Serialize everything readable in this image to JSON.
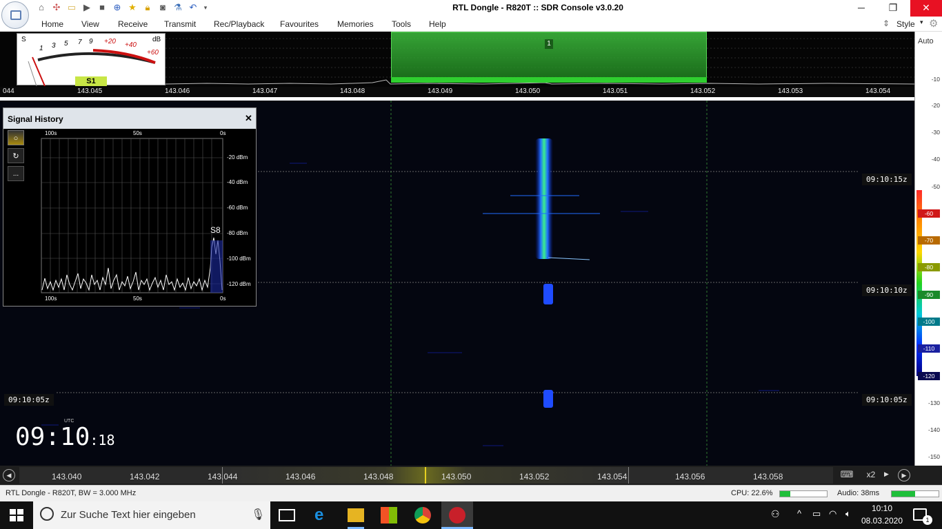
{
  "window": {
    "title": "RTL Dongle - R820T :: SDR Console v3.0.20",
    "minimize": "─",
    "restore": "❐",
    "close": "✕"
  },
  "quick_access": [
    "home-icon",
    "settings-icon",
    "folder-icon",
    "play-icon",
    "stop-icon",
    "add-icon",
    "star-icon",
    "lock-icon",
    "camera-icon",
    "flask-icon",
    "undo-icon",
    "dropdown-icon"
  ],
  "ribbon": {
    "tabs": [
      "Home",
      "View",
      "Receive",
      "Transmit",
      "Rec/Playback",
      "Favourites",
      "Memories",
      "Tools",
      "Help"
    ],
    "style_label": "Style"
  },
  "smeter": {
    "label_s": "S",
    "label_db": "dB",
    "ticks": [
      "1",
      "3",
      "5",
      "7",
      "9",
      "+20",
      "+40",
      "+60"
    ],
    "reading": "S1"
  },
  "spectrum": {
    "filter_marker": "1",
    "auto_label": "Auto",
    "freq_ticks": [
      "044",
      "143.045",
      "143.046",
      "143.047",
      "143.048",
      "143.049",
      "143.050",
      "143.051",
      "143.052",
      "143.053",
      "143.054"
    ]
  },
  "db_scale": {
    "top_ticks": [
      "-10",
      "-20",
      "-30",
      "-40",
      "-50"
    ],
    "color_ticks": [
      "-60",
      "-70",
      "-80",
      "-90",
      "-100",
      "-110",
      "-120"
    ],
    "bottom_ticks": [
      "-130",
      "-140",
      "-150"
    ]
  },
  "waterfall": {
    "time_labels": [
      "09:10:15z",
      "09:10:10z",
      "09:10:05z"
    ],
    "clock_utc_label": "UTC",
    "clock_hm": "09:10",
    "clock_s": ":18"
  },
  "signal_history": {
    "title": "Signal History",
    "close": "✕",
    "top_labels": [
      "100s",
      "50s",
      "0s"
    ],
    "bottom_labels": [
      "100s",
      "50s",
      "0s"
    ],
    "dbm_labels": [
      "-20 dBm",
      "-40 dBm",
      "-60 dBm",
      "-80 dBm",
      "-100 dBm",
      "-120 dBm"
    ],
    "s_reading": "S8",
    "more_button": "..."
  },
  "bottom_bar": {
    "freqs": [
      "143.040",
      "143.042",
      "143.044",
      "143.046",
      "143.048",
      "143.050",
      "143.052",
      "143.054",
      "143.056",
      "143.058"
    ],
    "zoom": "x2"
  },
  "status": {
    "left": "RTL Dongle - R820T, BW = 3.000 MHz",
    "cpu": "CPU: 22.6%",
    "audio": "Audio: 38ms",
    "cpu_level": 0.226,
    "audio_level": 0.5
  },
  "taskbar": {
    "search_placeholder": "Zur Suche Text hier eingeben",
    "time": "10:10",
    "date": "08.03.2020",
    "notification_count": "1"
  },
  "colors": {
    "accent_green": "#22b14c",
    "waterfall_bg": "#040610",
    "signal_color": "#2fd1ff"
  }
}
